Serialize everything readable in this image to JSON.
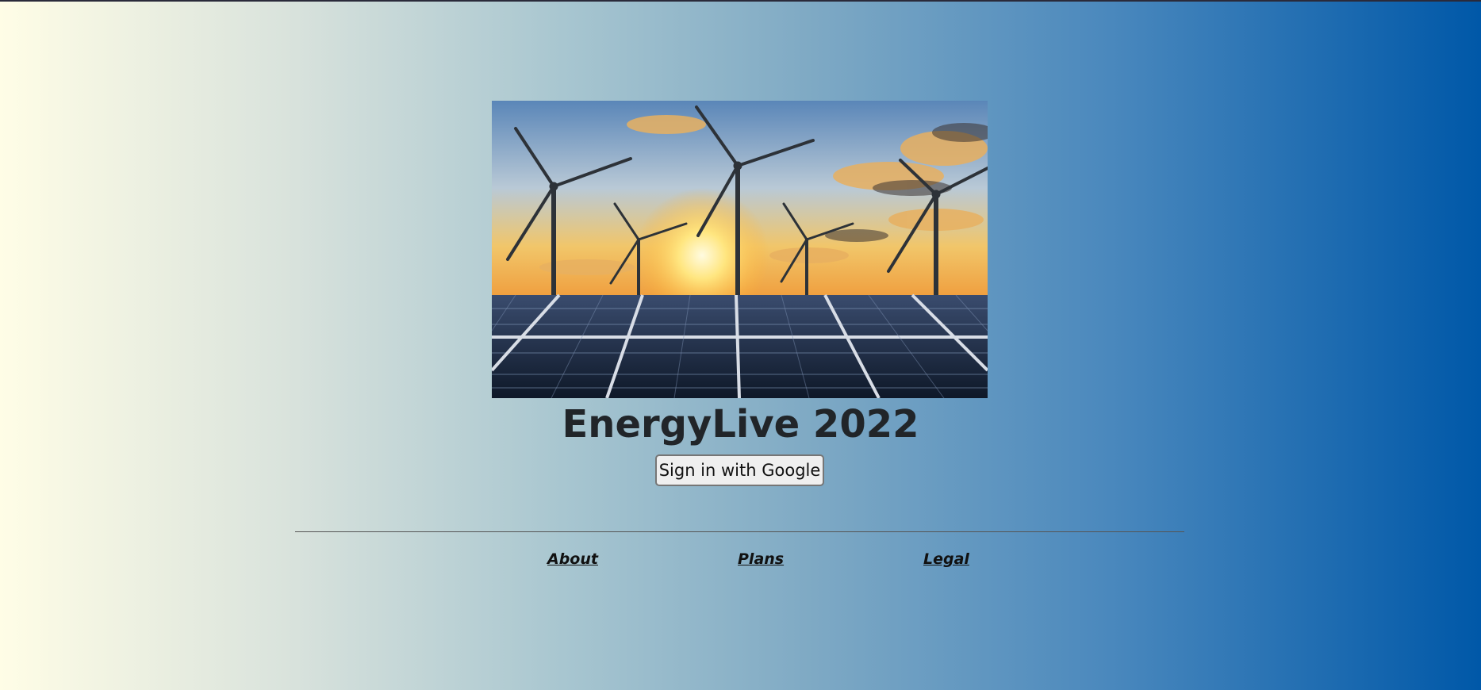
{
  "hero": {
    "image_description_icon": "wind-turbines-solar-panels-sunset-image"
  },
  "main": {
    "title": "EnergyLive 2022",
    "signin_label": "Sign in with Google"
  },
  "footer": {
    "links": [
      {
        "label": "About"
      },
      {
        "label": "Plans"
      },
      {
        "label": "Legal"
      }
    ]
  },
  "colors": {
    "background_left": "#fffde6",
    "background_right": "#0058a8",
    "title": "#212529"
  }
}
